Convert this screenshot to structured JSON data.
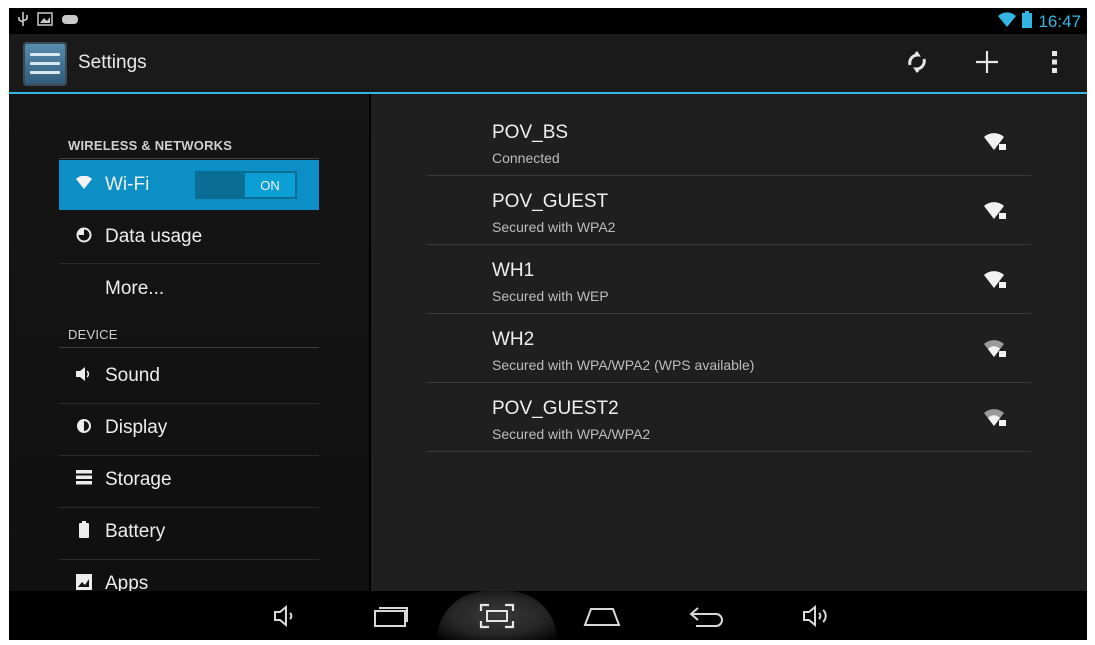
{
  "status_bar": {
    "time": "16:47"
  },
  "action_bar": {
    "title": "Settings"
  },
  "sidebar": {
    "wireless_header": "WIRELESS & NETWORKS",
    "device_header": "DEVICE",
    "items": [
      {
        "label": "Wi-Fi",
        "icon": "wifi-icon"
      },
      {
        "label": "Data usage",
        "icon": "data-usage-icon"
      },
      {
        "label": "More...",
        "icon": ""
      },
      {
        "label": "Sound",
        "icon": "speaker-icon"
      },
      {
        "label": "Display",
        "icon": "display-icon"
      },
      {
        "label": "Storage",
        "icon": "storage-icon"
      },
      {
        "label": "Battery",
        "icon": "battery-icon"
      },
      {
        "label": "Apps",
        "icon": "apps-icon"
      }
    ],
    "wifi_toggle": "ON"
  },
  "networks": [
    {
      "ssid": "POV_BS",
      "status": "Connected"
    },
    {
      "ssid": "POV_GUEST",
      "status": "Secured with WPA2"
    },
    {
      "ssid": "WH1",
      "status": "Secured with WEP"
    },
    {
      "ssid": "WH2",
      "status": "Secured with WPA/WPA2 (WPS available)"
    },
    {
      "ssid": "POV_GUEST2",
      "status": "Secured with WPA/WPA2"
    }
  ],
  "colors": {
    "accent": "#33b5e5",
    "selected": "#0b8fc4"
  }
}
